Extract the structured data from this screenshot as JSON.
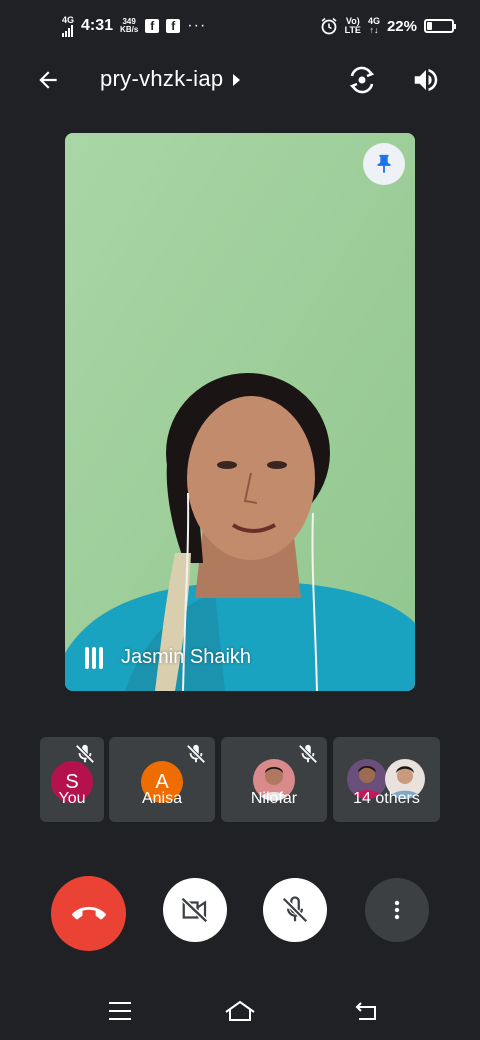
{
  "status_bar": {
    "network": "4G",
    "time": "4:31",
    "speed_value": "349",
    "speed_unit": "KB/s",
    "fb_icon_1": "f",
    "fb_icon_2": "f",
    "more_dots": "···",
    "volte_1": "Vo)",
    "volte_2": "LTE",
    "net2_top": "4G",
    "net2_bottom": "↑↓",
    "battery_percent": "22%",
    "battery_level": 0.22
  },
  "header": {
    "meeting_code": "pry-vhzk-iap",
    "back_icon": "arrow-back-icon",
    "flip_icon": "camera-flip-icon",
    "speaker_icon": "volume-icon"
  },
  "main_video": {
    "speaker_name": "Jasmin Shaikh",
    "pin_icon": "pin-icon",
    "background_color": "#9fd09b"
  },
  "participants": [
    {
      "name": "You",
      "initial": "S",
      "avatar_color": "#b5124d",
      "muted": true
    },
    {
      "name": "Anisa",
      "initial": "A",
      "avatar_color": "#ef6c00",
      "muted": true
    },
    {
      "name": "Nilofar",
      "initial": "",
      "avatar_color": "#d98a8a",
      "muted": true
    },
    {
      "name": "14 others",
      "initial": "",
      "avatar_color": "#6a4f7a",
      "muted": false
    }
  ],
  "controls": {
    "end_call_color": "#ea4335",
    "end_call_icon": "phone-hangup-icon",
    "camera_icon": "camera-off-icon",
    "mic_icon": "mic-off-icon",
    "more_icon": "more-vertical-icon"
  },
  "nav_bar": {
    "menu_icon": "menu-icon",
    "home_icon": "home-icon",
    "back_icon": "nav-back-icon"
  }
}
